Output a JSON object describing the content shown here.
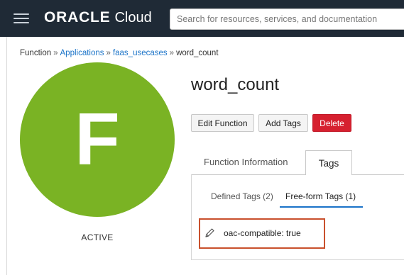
{
  "header": {
    "brand": "ORACLE",
    "product": "Cloud",
    "search_placeholder": "Search for resources, services, and documentation",
    "bar_color": "#1f2a36"
  },
  "breadcrumb": {
    "items": [
      "Function",
      "Applications",
      "faas_usecases",
      "word_count"
    ],
    "separator": "»",
    "link_color": "#1a73c8"
  },
  "function": {
    "name": "word_count",
    "avatar_letter": "F",
    "avatar_color": "#7ab324",
    "status": "ACTIVE"
  },
  "actions": {
    "edit": "Edit Function",
    "add_tags": "Add Tags",
    "delete": "Delete",
    "delete_color": "#d6202f"
  },
  "tabs": {
    "items": [
      "Function Information",
      "Tags"
    ],
    "active": "Tags"
  },
  "tag_tabs": {
    "defined": "Defined Tags (2)",
    "free_form": "Free-form Tags (1)",
    "active": "Free-form Tags (1)"
  },
  "free_form_tags": [
    {
      "text": "oac-compatible: true"
    }
  ],
  "highlight_color": "#c9502c",
  "icons": [
    "menu-icon",
    "pencil-icon"
  ]
}
